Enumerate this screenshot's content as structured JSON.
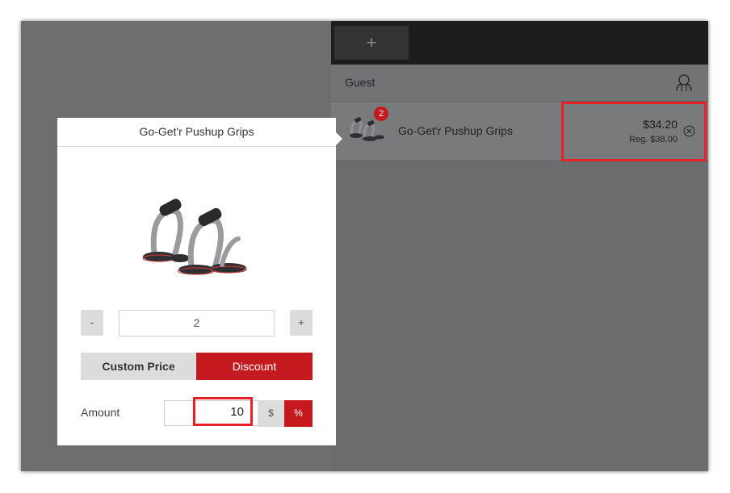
{
  "header": {
    "add_tab_label": "+"
  },
  "customer": {
    "label": "Guest",
    "icon": "user-outline-icon"
  },
  "cart": {
    "items": [
      {
        "name": "Go-Get'r Pushup Grips",
        "quantity_badge": "2",
        "price": "$34.20",
        "regular_price": "Reg. $38.00",
        "remove_icon": "close-circle-icon"
      }
    ]
  },
  "editor": {
    "title": "Go-Get'r Pushup Grips",
    "quantity": {
      "decrement_label": "-",
      "value": "2",
      "increment_label": "+"
    },
    "tabs": [
      {
        "label": "Custom Price",
        "active": false
      },
      {
        "label": "Discount",
        "active": true
      }
    ],
    "amount": {
      "label": "Amount",
      "value": "10",
      "unit_dollar": "$",
      "unit_percent": "%",
      "selected_unit": "%"
    }
  },
  "colors": {
    "accent": "#c41a1f",
    "highlight": "#e8202a",
    "dark_bar": "#1d1d1f"
  }
}
